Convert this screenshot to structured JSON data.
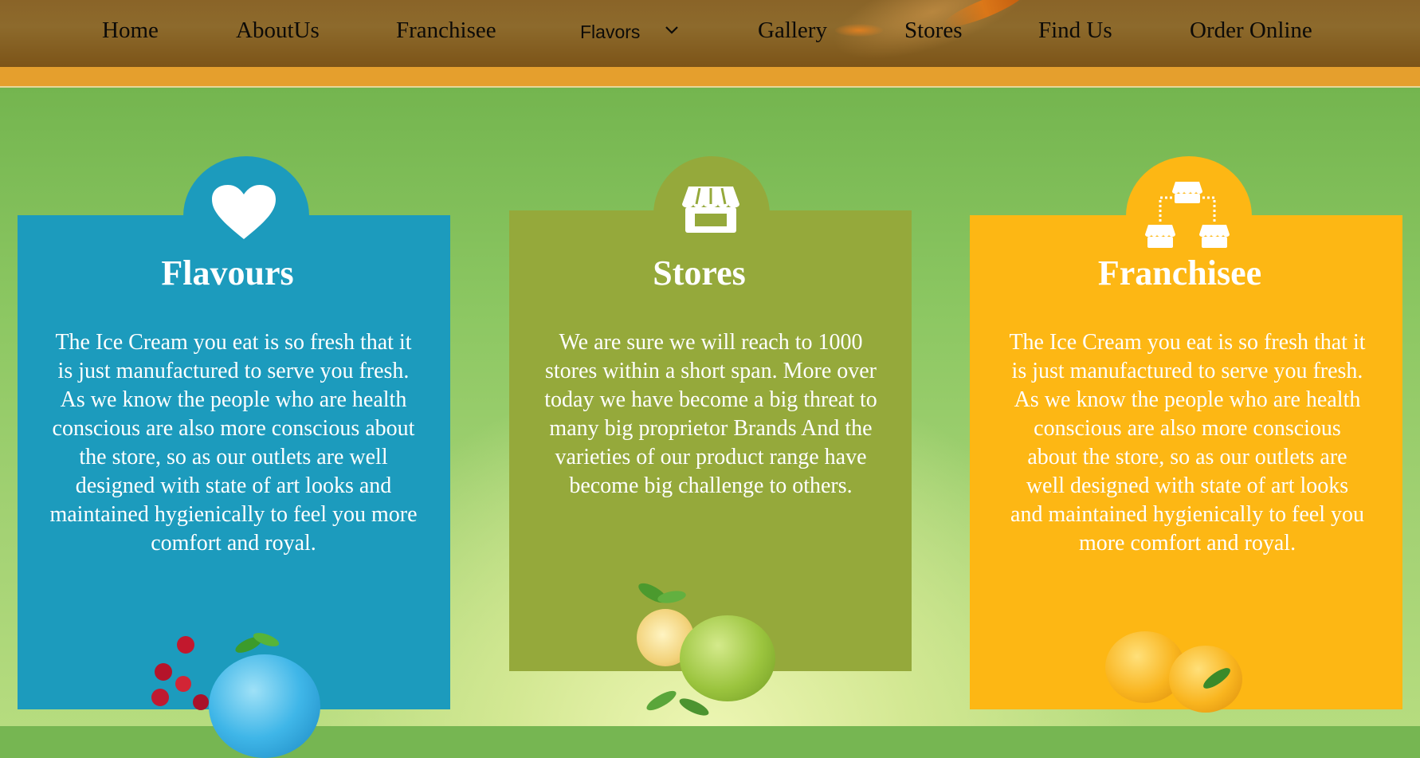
{
  "nav": {
    "items": [
      {
        "label": "Home"
      },
      {
        "label": "AboutUs"
      },
      {
        "label": "Franchisee"
      },
      {
        "label": "Flavors"
      },
      {
        "label": "Gallery"
      },
      {
        "label": "Stores"
      },
      {
        "label": "Find Us"
      },
      {
        "label": "Order Online"
      }
    ]
  },
  "cards": [
    {
      "title": "Flavours",
      "icon": "heart-icon",
      "color": "#1c9bbd",
      "text": "The Ice Cream you eat is so fresh that it is just manufactured to serve you fresh. As we know the people who are health conscious are also more conscious about the store, so as our outlets are well designed with state of art looks and maintained hygienically to feel you more comfort and royal."
    },
    {
      "title": "Stores",
      "icon": "store-icon",
      "color": "#95a93b",
      "text": "We are sure we will reach to 1000 stores within a short span. More over today we have become a big threat to many big proprietor Brands And the varieties of our product range have become big challenge to others."
    },
    {
      "title": "Franchisee",
      "icon": "franchise-network-icon",
      "color": "#fdb714",
      "text": "The Ice Cream you eat is so fresh that it is just manufactured to serve you fresh. As we know the people who are health conscious are also more conscious about the store, so as our outlets are well designed with state of art looks and maintained hygienically to feel you more comfort and royal."
    }
  ]
}
